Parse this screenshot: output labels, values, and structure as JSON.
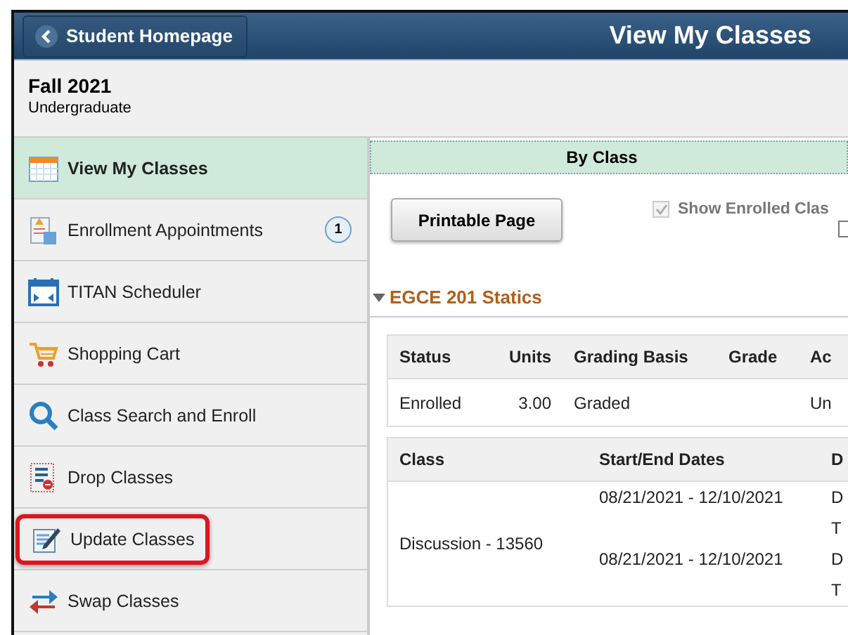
{
  "header": {
    "back_button": "Student Homepage",
    "title": "View My Classes"
  },
  "term": {
    "name": "Fall 2021",
    "career": "Undergraduate"
  },
  "sidebar": {
    "items": [
      {
        "label": "View My Classes",
        "selected": true,
        "highlighted": false
      },
      {
        "label": "Enrollment Appointments",
        "selected": false,
        "highlighted": false,
        "badge": "1"
      },
      {
        "label": "TITAN Scheduler",
        "selected": false,
        "highlighted": false
      },
      {
        "label": "Shopping Cart",
        "selected": false,
        "highlighted": false
      },
      {
        "label": "Class Search and Enroll",
        "selected": false,
        "highlighted": false
      },
      {
        "label": "Drop Classes",
        "selected": false,
        "highlighted": false
      },
      {
        "label": "Update Classes",
        "selected": false,
        "highlighted": true
      },
      {
        "label": "Swap Classes",
        "selected": false,
        "highlighted": false
      }
    ]
  },
  "view_tab": {
    "label": "By Class",
    "selected": true
  },
  "printable_button": "Printable Page",
  "checkboxes": [
    {
      "label": "Show Enrolled Clas",
      "checked": true,
      "disabled": true
    },
    {
      "checked": false
    }
  ],
  "course": {
    "title": "EGCE 201 Statics",
    "expanded": true
  },
  "status_table": {
    "columns": [
      "Status",
      "Units",
      "Grading Basis",
      "Grade",
      "Ac"
    ],
    "rows": [
      [
        "Enrolled",
        "3.00",
        "Graded",
        "",
        "Un"
      ]
    ]
  },
  "class_table": {
    "columns": [
      "Class",
      "Start/End Dates",
      "D"
    ],
    "rows": [
      {
        "class": "Discussion - 13560",
        "meetings": [
          {
            "dates": "08/21/2021 - 12/10/2021",
            "column_3": [
              "D",
              "T"
            ]
          },
          {
            "dates": "08/21/2021 - 12/10/2021",
            "column_3": [
              "D",
              "T"
            ]
          }
        ]
      }
    ]
  }
}
